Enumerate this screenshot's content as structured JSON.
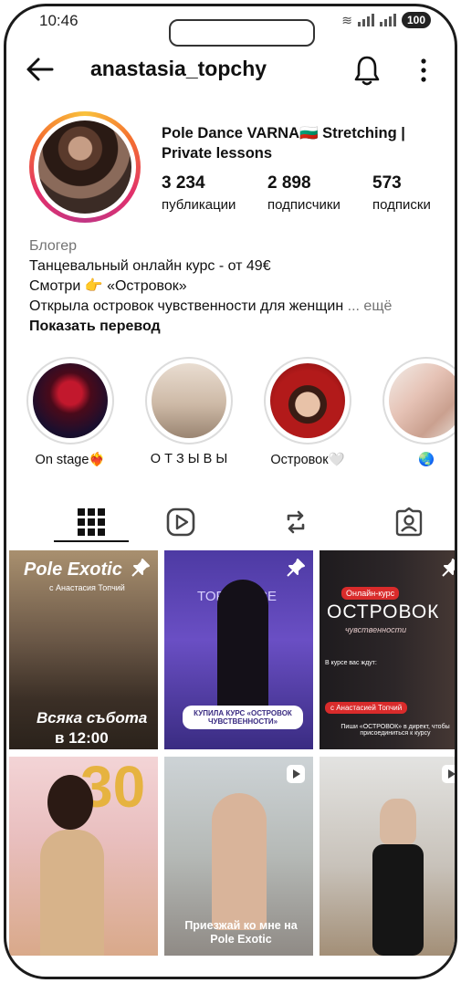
{
  "status_bar": {
    "time": "10:46",
    "battery": "100"
  },
  "header": {
    "username": "anastasia_topchy"
  },
  "profile": {
    "name": "Pole Dance VARNA🇧🇬 Stretching | Private lessons",
    "stats": [
      {
        "value": "3 234",
        "label": "публикации"
      },
      {
        "value": "2 898",
        "label": "подписчики"
      },
      {
        "value": "573",
        "label": "подписки"
      }
    ],
    "category": "Блогер",
    "bio_lines": [
      "Танцевальный онлайн курс - от 49€",
      "Смотри 👉 «Островок»",
      "Открыла островок чувственности для женщин"
    ],
    "more": "... ещё",
    "translate": "Показать перевод"
  },
  "highlights": [
    {
      "label": "On stage❤️‍🔥"
    },
    {
      "label": "О Т З Ы В Ы"
    },
    {
      "label": "Островок🤍"
    },
    {
      "label": "🌏"
    }
  ],
  "posts": [
    {
      "line1": "Pole Exotic",
      "line2": "с Анастасия Топчий",
      "line3": "Всяка събота",
      "line4": "в 12:00"
    },
    {
      "line1": "TOP DANCE",
      "line2": "КУПИЛА КУРС «ОСТРОВОК ЧУВСТВЕННОСТИ»"
    },
    {
      "line1": "Онлайн-курс",
      "line2": "ОСТРОВОК",
      "line3": "чувственности",
      "line4": "В курсе вас ждут:",
      "line5": "с Анастасией Топчий",
      "line6": "Пиши «ОСТРОВОК» в директ, чтобы присоединиться к курсу"
    },
    {
      "line1": "30"
    },
    {
      "line1": "Приезжай ко мне на Pole Exotic"
    },
    {
      "line1": ""
    }
  ],
  "colors": {
    "text": "#111111",
    "muted": "#737373",
    "story_ring": "#dcdcdc"
  }
}
